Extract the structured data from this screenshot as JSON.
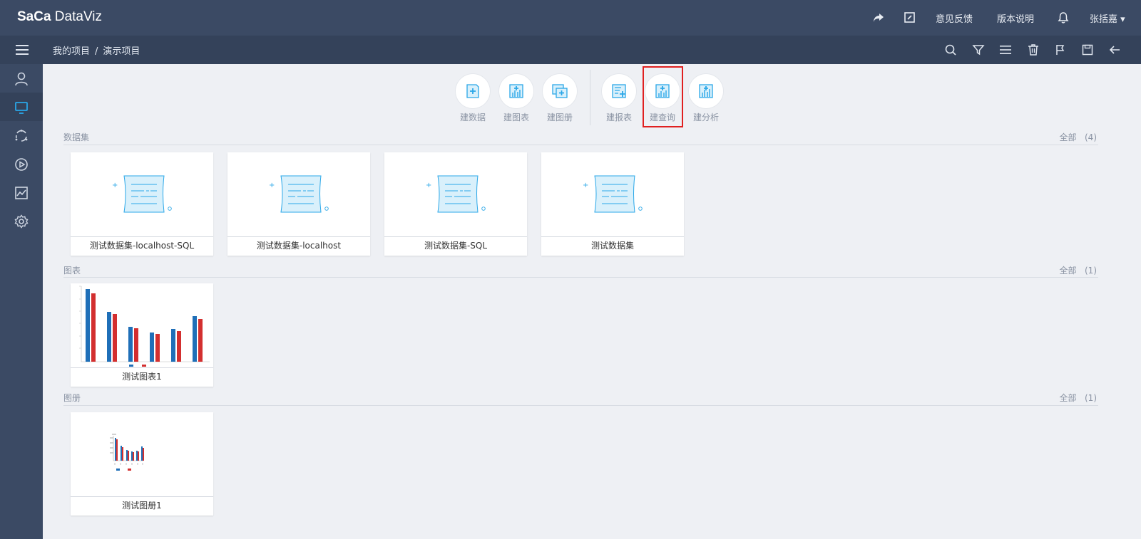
{
  "app": {
    "logo": "SaCa DataViz"
  },
  "topbar": {
    "share_icon": "share-icon",
    "edit_icon": "edit-icon",
    "feedback": "意见反馈",
    "release_notes": "版本说明",
    "bell_icon": "bell-icon",
    "user": "张括嘉 ▾"
  },
  "breadcrumb": {
    "root": "我的项目",
    "sep": "/",
    "current": "演示项目"
  },
  "toolbar": {
    "items": [
      {
        "label": "建数据",
        "icon": "new-data-icon"
      },
      {
        "label": "建图表",
        "icon": "new-chart-icon"
      },
      {
        "label": "建图册",
        "icon": "new-album-icon"
      },
      {
        "label": "建报表",
        "icon": "new-report-icon"
      },
      {
        "label": "建查询",
        "icon": "new-query-icon"
      },
      {
        "label": "建分析",
        "icon": "new-analysis-icon"
      }
    ]
  },
  "sections": {
    "datasets": {
      "title": "数据集",
      "all": "全部",
      "count": "(4)",
      "cards": [
        "测试数据集-localhost-SQL",
        "测试数据集-localhost",
        "测试数据集-SQL",
        "测试数据集"
      ]
    },
    "charts": {
      "title": "图表",
      "all": "全部",
      "count": "(1)",
      "cards": [
        "测试图表1"
      ]
    },
    "albums": {
      "title": "图册",
      "all": "全部",
      "count": "(1)",
      "cards": [
        "测试图册1"
      ]
    }
  },
  "colors": {
    "topbar": "#3b4a64",
    "subbar": "#34425a",
    "accent": "#2aa7e8",
    "highlight": "#e02020",
    "bar_blue": "#1f6fb8",
    "bar_red": "#d32f2f"
  }
}
